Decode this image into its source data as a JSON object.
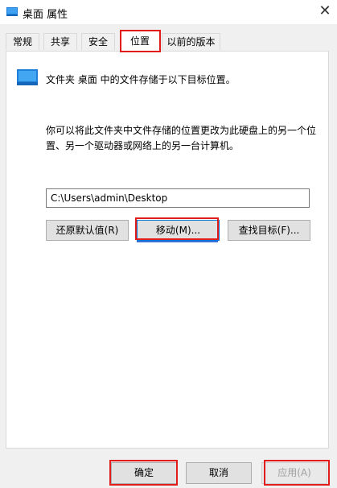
{
  "window": {
    "title": "桌面 属性",
    "close_symbol": "✕"
  },
  "tabs": [
    {
      "label": "常规"
    },
    {
      "label": "共享"
    },
    {
      "label": "安全"
    },
    {
      "label": "位置",
      "active": true
    },
    {
      "label": "以前的版本"
    }
  ],
  "location": {
    "info": "文件夹 桌面 中的文件存储于以下目标位置。",
    "description": "你可以将此文件夹中文件存储的位置更改为此硬盘上的另一个位置、另一个驱动器或网络上的另一台计算机。",
    "path_value": "C:\\Users\\admin\\Desktop",
    "restore_default_label": "还原默认值(R)",
    "move_label": "移动(M)...",
    "find_target_label": "查找目标(F)..."
  },
  "footer": {
    "ok_label": "确定",
    "cancel_label": "取消",
    "apply_label": "应用(A)"
  },
  "icons": {
    "folder": "folder-icon",
    "close": "close-icon"
  },
  "colors": {
    "highlight_red": "#e21b1b",
    "folder_blue": "#1e7fd8"
  }
}
